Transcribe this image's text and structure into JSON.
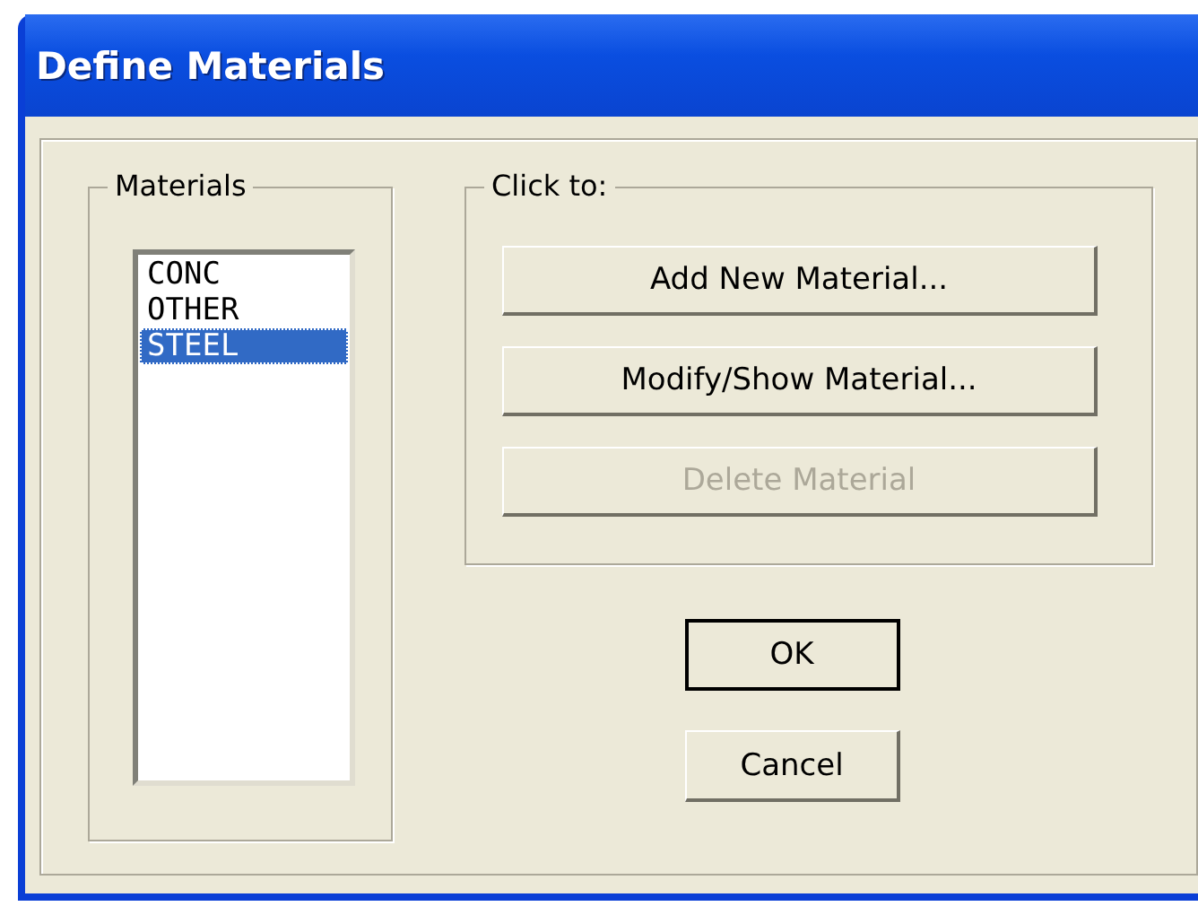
{
  "window": {
    "title": "Define Materials"
  },
  "materials": {
    "label": "Materials",
    "items": [
      {
        "name": "CONC",
        "selected": false
      },
      {
        "name": "OTHER",
        "selected": false
      },
      {
        "name": "STEEL",
        "selected": true
      }
    ]
  },
  "actions": {
    "label": "Click to:",
    "buttons": [
      {
        "label": "Add New Material...",
        "disabled": false
      },
      {
        "label": "Modify/Show Material...",
        "disabled": false
      },
      {
        "label": "Delete Material",
        "disabled": true
      }
    ]
  },
  "dialog_buttons": [
    {
      "label": "OK",
      "default": true
    },
    {
      "label": "Cancel",
      "default": false
    }
  ]
}
